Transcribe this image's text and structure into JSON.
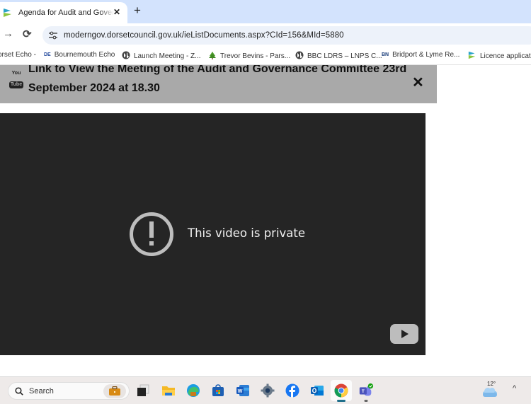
{
  "browser": {
    "tab": {
      "title": "Agenda for Audit and Governance Committee",
      "favicon": "dorset-council-favicon"
    },
    "new_tab_label": "+",
    "close_tab_label": "✕",
    "nav": {
      "forward_icon": "→",
      "reload_icon": "⟳"
    },
    "url": "moderngov.dorsetcouncil.gov.uk/ieListDocuments.aspx?CId=156&MId=5880",
    "bookmarks": [
      {
        "label": "orset Echo -",
        "icon": "none"
      },
      {
        "label": "Bournemouth Echo",
        "icon": "de-logo"
      },
      {
        "label": "Launch Meeting - Z...",
        "icon": "globe-icon"
      },
      {
        "label": "Trevor Bevins - Pars...",
        "icon": "tree-icon"
      },
      {
        "label": "BBC LDRS – LNPS C...",
        "icon": "globe-icon"
      },
      {
        "label": "Bridport & Lyme Re...",
        "icon": "bn-logo"
      },
      {
        "label": "Licence applicatio",
        "icon": "dorset-council-favicon"
      }
    ]
  },
  "page": {
    "banner": {
      "title": "Link to View the Meeting of the Audit and Governance Committee 23rd September 2024 at 18.30",
      "logo_top": "You",
      "logo_bottom": "Tube",
      "close_label": "✕"
    },
    "player": {
      "message": "This video is private",
      "message_icon": "exclamation-circle-icon"
    }
  },
  "taskbar": {
    "search_label": "Search",
    "apps": [
      "work-bag",
      "task-view",
      "file-explorer",
      "edge",
      "microsoft-store",
      "word",
      "settings",
      "facebook",
      "outlook",
      "chrome",
      "teams"
    ],
    "active_app": "chrome",
    "weather_temp": "12°",
    "tray_chevron": "^"
  }
}
